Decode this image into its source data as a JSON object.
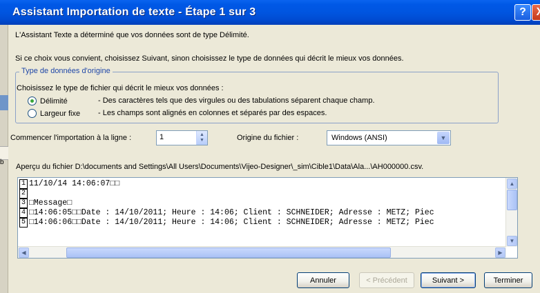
{
  "window": {
    "title": "Assistant Importation de texte - Étape 1 sur 3",
    "help_icon": "?",
    "close_icon": "X"
  },
  "background_text": "b",
  "intro": {
    "line1": "L'Assistant Texte a déterminé que vos données sont de type Délimité.",
    "line2": "Si ce choix vous convient, choisissez Suivant, sinon choisissez le type de données qui décrit le mieux vos données."
  },
  "data_type": {
    "legend": "Type de données d'origine",
    "prompt": "Choisissez le type de fichier qui décrit le mieux vos données :",
    "options": [
      {
        "label": "Délimité",
        "description": "- Des caractères tels que des virgules ou des tabulations séparent chaque champ.",
        "selected": true
      },
      {
        "label": "Largeur fixe",
        "description": "- Les champs sont alignés en colonnes et séparés par des espaces.",
        "selected": false
      }
    ]
  },
  "import_start": {
    "label": "Commencer l'importation à la ligne :",
    "value": "1"
  },
  "file_origin": {
    "label": "Origine du fichier :",
    "value": "Windows (ANSI)"
  },
  "preview": {
    "label": "Aperçu du fichier D:\\documents and Settings\\All Users\\Documents\\Vijeo-Designer\\_sim\\Cible1\\Data\\Ala...\\AH000000.csv.",
    "lines": [
      {
        "num": "1",
        "text": "11/10/14 14:06:07□□"
      },
      {
        "num": "2",
        "text": ""
      },
      {
        "num": "3",
        "text": "□Message□"
      },
      {
        "num": "4",
        "text": "□14:06:05□□Date : 14/10/2011; Heure : 14:06; Client : SCHNEIDER; Adresse : METZ; Piec"
      },
      {
        "num": "5",
        "text": "□14:06:06□□Date : 14/10/2011; Heure : 14:06; Client : SCHNEIDER; Adresse : METZ; Piec"
      }
    ]
  },
  "buttons": {
    "cancel": "Annuler",
    "previous": "< Précédent",
    "next": "Suivant >",
    "finish": "Terminer"
  }
}
